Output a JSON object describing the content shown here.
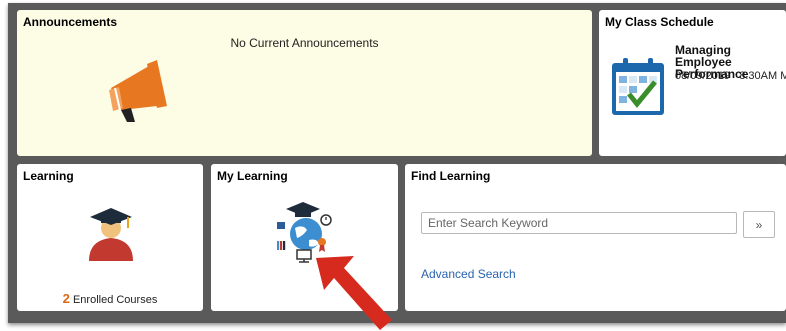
{
  "tiles": {
    "announcements": {
      "title": "Announcements",
      "message": "No Current Announcements"
    },
    "schedule": {
      "title": "My Class Schedule",
      "course": "Managing Employee Performance",
      "date": "08/09/2019",
      "time": "8:30AM M"
    },
    "learning": {
      "title": "Learning",
      "enrolled_count": "2",
      "enrolled_label": "Enrolled Courses"
    },
    "my_learning": {
      "title": "My Learning"
    },
    "find_learning": {
      "title": "Find Learning",
      "search_placeholder": "Enter Search Keyword",
      "search_button": "»",
      "advanced_search": "Advanced Search"
    }
  },
  "icons": {
    "announcements": "megaphone-icon",
    "schedule": "calendar-check-icon",
    "learning": "graduate-icon",
    "my_learning": "learning-globe-icon",
    "annotation": "red-arrow-icon"
  },
  "colors": {
    "announcement_bg": "#fdfde6",
    "accent_orange": "#e87722",
    "link_blue": "#2a63b0",
    "arrow_red": "#d62a1e"
  }
}
